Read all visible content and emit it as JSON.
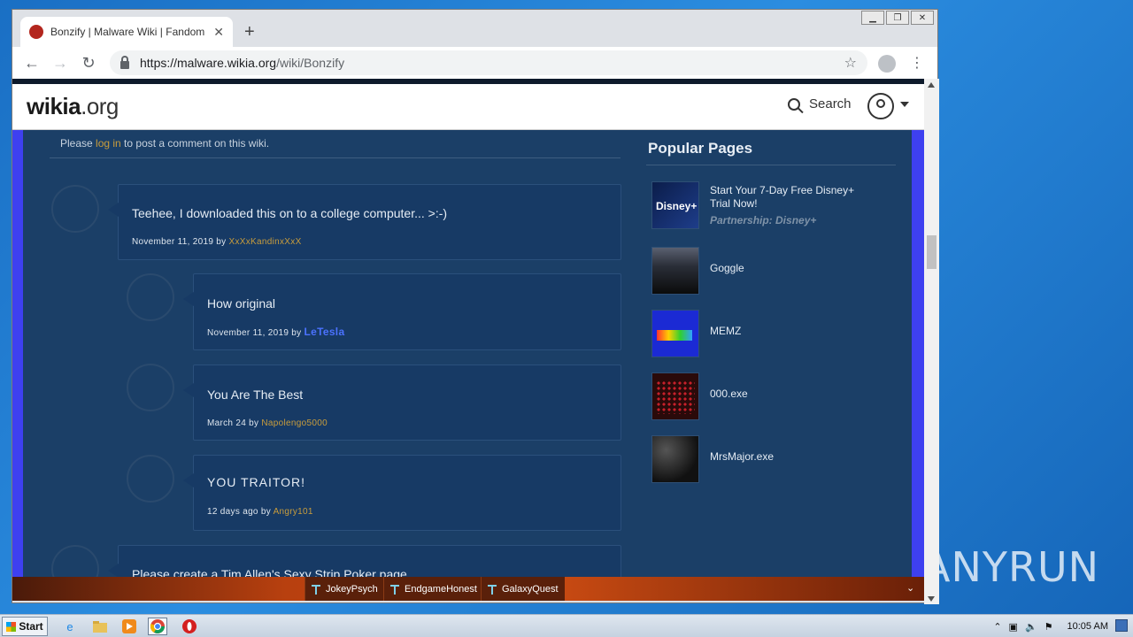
{
  "browser": {
    "tab_title": "Bonzify | Malware Wiki | Fandom",
    "tab_close": "✕",
    "new_tab": "+",
    "url_host": "https://malware.wikia.org",
    "url_path": "/wiki/Bonzify",
    "back": "←",
    "forward": "→",
    "reload": "↻",
    "star": "☆",
    "menu": "⋮",
    "window_minimize": "▁",
    "window_restore": "❐",
    "window_close": "✕"
  },
  "wiki": {
    "logo_main": "wikia",
    "logo_tld": ".org",
    "search_label": "Search"
  },
  "comments": {
    "login_prefix": "Please ",
    "login_link": "log in",
    "login_suffix": " to post a comment on this wiki.",
    "items": [
      {
        "text": "Teehee, I downloaded this on to a college computer... >:-)",
        "date": "November 11, 2019 by ",
        "author": "XxXxKandinxXxX"
      },
      {
        "text": "How original",
        "date": "November 11, 2019 by ",
        "author": "LeTesla"
      },
      {
        "text": "You Are The Best",
        "date": "March 24 by ",
        "author": "Napolengo5000"
      },
      {
        "text": "YOU TRAITOR!",
        "date": "12 days ago by ",
        "author": "Angry101"
      },
      {
        "text": "Please create a Tim Allen's Sexy Strip Poker page"
      }
    ]
  },
  "sidebar": {
    "title": "Popular Pages",
    "items": [
      {
        "label": "Start Your 7-Day Free Disney+ Trial Now!",
        "sub": "Partnership: Disney+",
        "thumb_label": "Disney+"
      },
      {
        "label": "Goggle"
      },
      {
        "label": "MEMZ"
      },
      {
        "label": "000.exe"
      },
      {
        "label": "MrsMajor.exe"
      }
    ]
  },
  "fandom_bar": {
    "items": [
      "JokeyPsych",
      "EndgameHonest",
      "GalaxyQuest"
    ],
    "expand": "⌄"
  },
  "taskbar": {
    "start": "Start",
    "clock": "10:05 AM"
  },
  "watermark": {
    "left": "ANY",
    "right": "RUN"
  }
}
